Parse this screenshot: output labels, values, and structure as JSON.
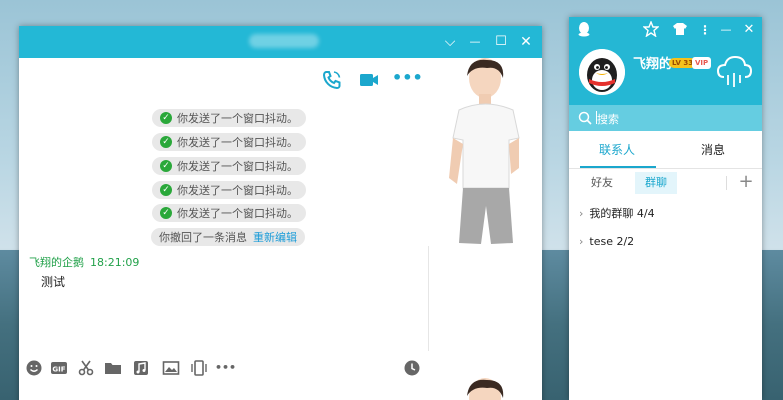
{
  "chat_window": {
    "title": "cdhtryan",
    "controls": {
      "dropdown": "⌵",
      "minimize": "—",
      "maximize": "☐",
      "close": "✕"
    },
    "system_messages": [
      {
        "text": "你发送了一个窗口抖动。"
      },
      {
        "text": "你发送了一个窗口抖动。"
      },
      {
        "text": "你发送了一个窗口抖动。"
      },
      {
        "text": "你发送了一个窗口抖动。"
      },
      {
        "text": "你发送了一个窗口抖动。"
      }
    ],
    "recall": {
      "text": "你撤回了一条消息",
      "link": "重新编辑"
    },
    "message": {
      "sender": "飞翔的企鹅",
      "time": "18:21:09",
      "text": "测试"
    },
    "toolbar_more": "•••"
  },
  "contact_panel": {
    "nickname": "飞翔的",
    "level": "LV 33",
    "vip": "VIP",
    "search_placeholder": "搜索",
    "tabs": [
      {
        "label": "联系人"
      },
      {
        "label": "消息"
      }
    ],
    "segments": [
      {
        "label": "好友"
      },
      {
        "label": "群聊"
      }
    ],
    "add": "+",
    "groups": [
      {
        "arrow": "›",
        "label": "我的群聊 4/4"
      },
      {
        "arrow": "›",
        "label": "tese 2/2"
      }
    ],
    "controls": {
      "minimize": "—",
      "close": "✕"
    }
  },
  "colors": {
    "accent": "#23b8d6",
    "link": "#1c9cd8",
    "green": "#22a14a"
  }
}
